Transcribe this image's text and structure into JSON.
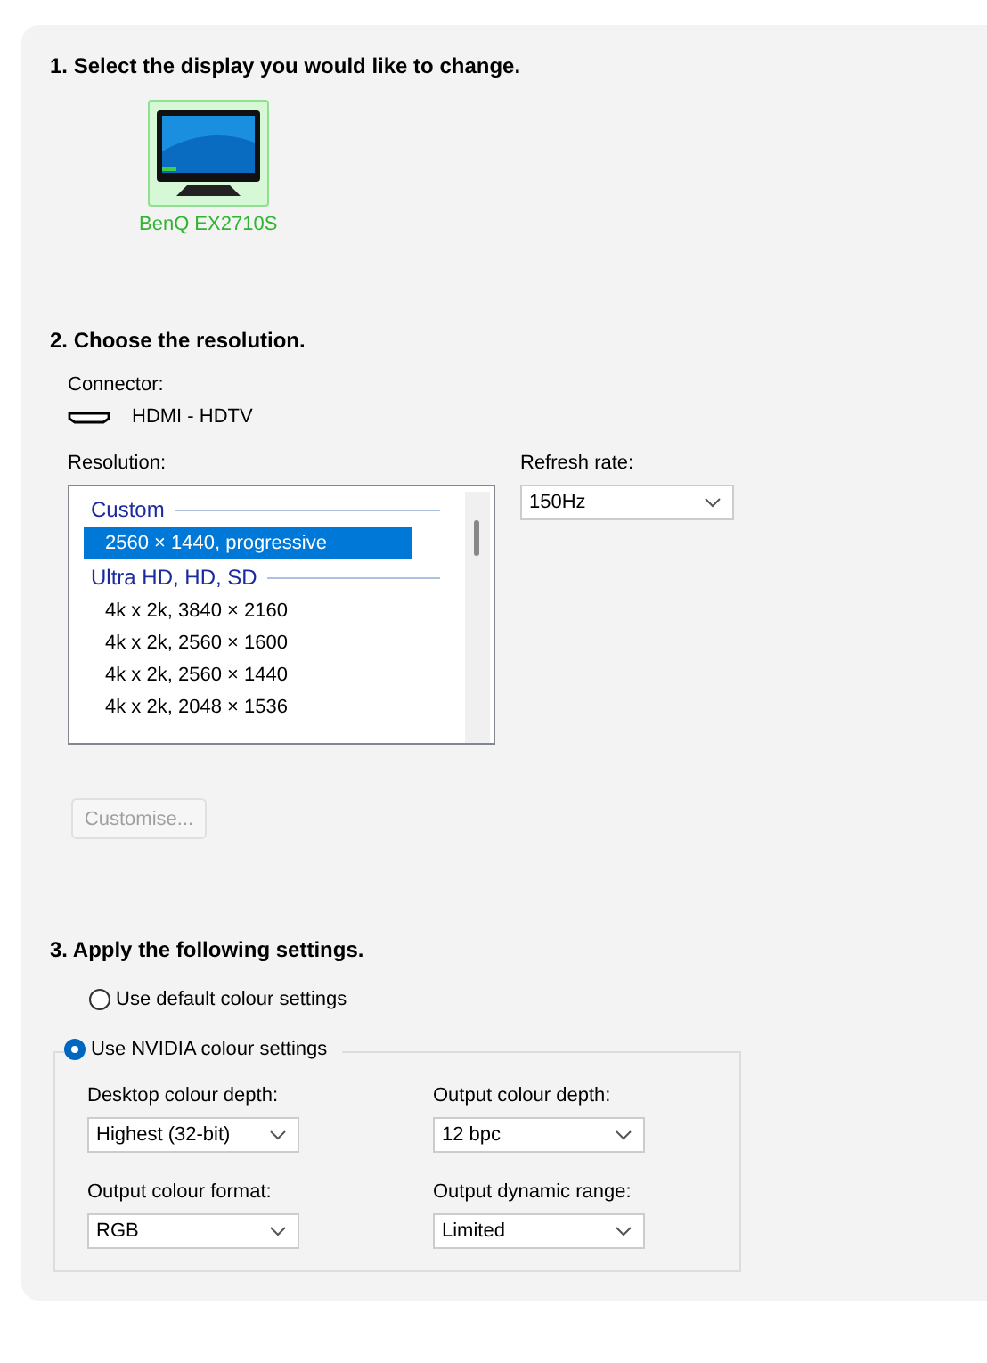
{
  "step1": {
    "heading": "1. Select the display you would like to change.",
    "displays": [
      {
        "name": "BenQ EX2710S",
        "selected": true
      }
    ]
  },
  "step2": {
    "heading": "2. Choose the resolution.",
    "connector_label": "Connector:",
    "connector": "HDMI - HDTV",
    "resolution_label": "Resolution:",
    "resolutions": [
      {
        "kind": "group",
        "label": "Custom"
      },
      {
        "kind": "option",
        "label": "2560 × 1440, progressive",
        "selected": true
      },
      {
        "kind": "group",
        "label": "Ultra HD, HD, SD"
      },
      {
        "kind": "option",
        "label": "4k x 2k, 3840 × 2160",
        "selected": false
      },
      {
        "kind": "option",
        "label": "4k x 2k, 2560 × 1600",
        "selected": false
      },
      {
        "kind": "option",
        "label": "4k x 2k, 2560 × 1440",
        "selected": false
      },
      {
        "kind": "option",
        "label": "4k x 2k, 2048 × 1536",
        "selected": false
      }
    ],
    "refresh_label": "Refresh rate:",
    "refresh_rate": "150Hz",
    "customise_button": {
      "label": "Customise...",
      "disabled": true
    }
  },
  "step3": {
    "heading": "3. Apply the following settings.",
    "options": [
      {
        "label": "Use default colour settings",
        "selected": false
      },
      {
        "label": "Use NVIDIA colour settings",
        "selected": true
      }
    ],
    "fields": [
      {
        "label": "Desktop colour depth:",
        "value": "Highest (32-bit)"
      },
      {
        "label": "Output colour depth:",
        "value": "12 bpc"
      },
      {
        "label": "Output colour format:",
        "value": "RGB"
      },
      {
        "label": "Output dynamic range:",
        "value": "Limited"
      }
    ]
  }
}
